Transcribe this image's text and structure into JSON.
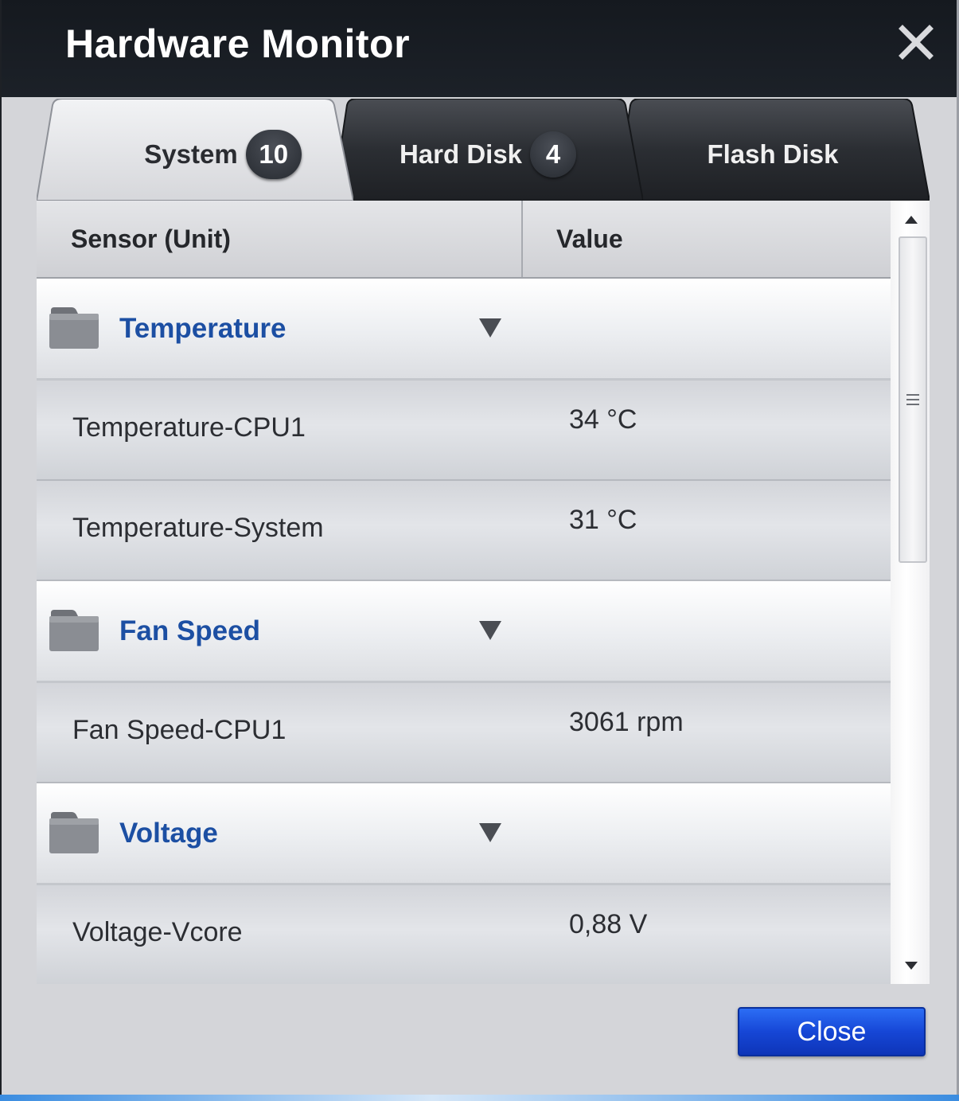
{
  "window": {
    "title": "Hardware Monitor"
  },
  "tabs": [
    {
      "label": "System",
      "badge": "10",
      "active": true
    },
    {
      "label": "Hard Disk",
      "badge": "4",
      "active": false
    },
    {
      "label": "Flash Disk",
      "active": false
    }
  ],
  "table": {
    "headers": {
      "sensor": "Sensor (Unit)",
      "value": "Value"
    },
    "groups": [
      {
        "label": "Temperature",
        "rows": [
          {
            "sensor": "Temperature-CPU1",
            "value": "34 °C"
          },
          {
            "sensor": "Temperature-System",
            "value": "31 °C"
          }
        ]
      },
      {
        "label": "Fan Speed",
        "rows": [
          {
            "sensor": "Fan Speed-CPU1",
            "value": "3061 rpm"
          }
        ]
      },
      {
        "label": "Voltage",
        "rows": [
          {
            "sensor": "Voltage-Vcore",
            "value": "0,88 V"
          }
        ]
      }
    ]
  },
  "footer": {
    "close_label": "Close"
  },
  "colors": {
    "title_bar": "#15191f",
    "group_label": "#1c4fa3",
    "close_button": "#1646d6"
  },
  "icons": [
    "close-icon",
    "folder-icon",
    "collapse-arrow-icon",
    "scroll-up-arrow-icon",
    "scroll-down-arrow-icon",
    "scroll-grip-icon"
  ]
}
